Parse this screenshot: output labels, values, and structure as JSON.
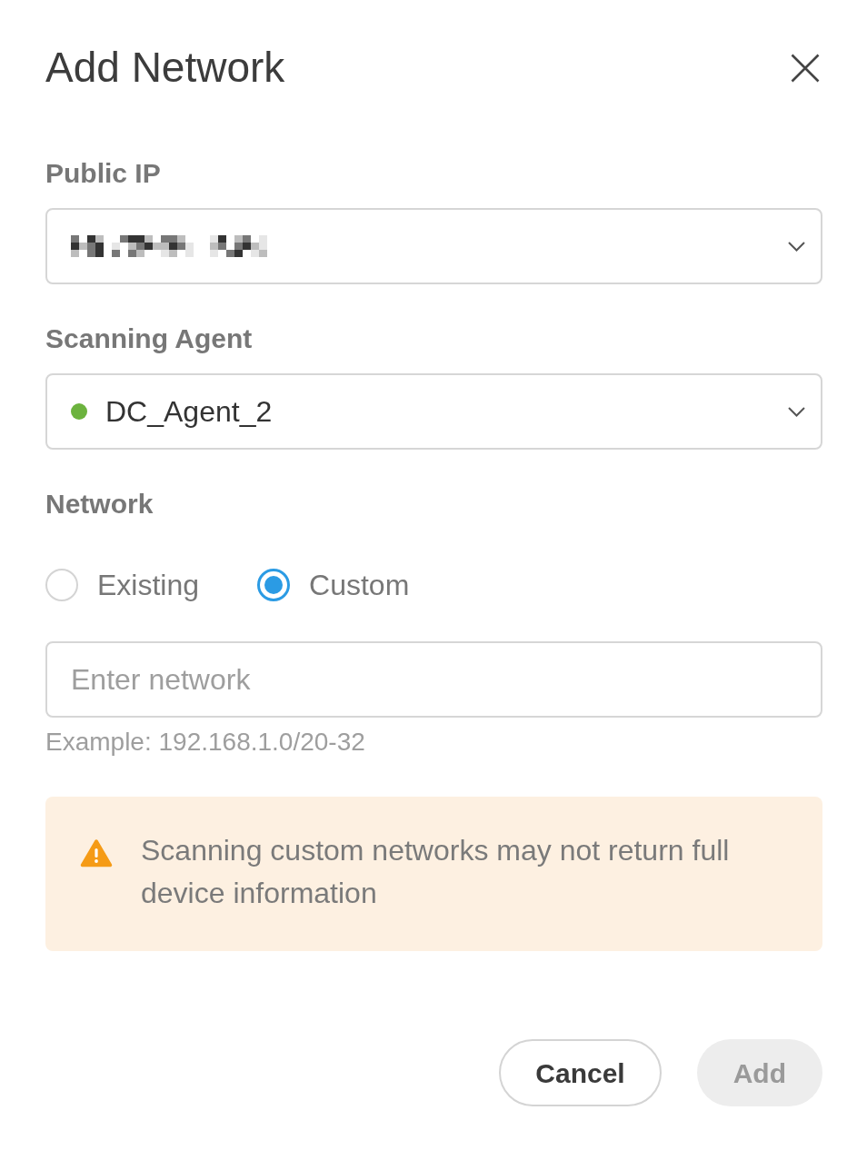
{
  "dialog": {
    "title": "Add Network"
  },
  "fields": [
    {
      "kind": "select",
      "label": "Public IP",
      "redacted": true
    },
    {
      "kind": "select",
      "label": "Scanning Agent",
      "value": "DC_Agent_2",
      "color": "#6cb33e"
    }
  ],
  "network": {
    "label": "Network",
    "options": [
      {
        "label": "Existing",
        "selected": false
      },
      {
        "label": "Custom",
        "selected": true
      }
    ],
    "input": {
      "placeholder": "Enter network"
    },
    "hint": "Example: 192.168.1.0/20-32"
  },
  "alert": {
    "kind": "warning",
    "text": "Scanning custom networks may not return full device information"
  },
  "buttons": [
    {
      "label": "Cancel",
      "kind": "outline",
      "disabled": false
    },
    {
      "label": "Add",
      "kind": "primary",
      "disabled": true
    }
  ]
}
